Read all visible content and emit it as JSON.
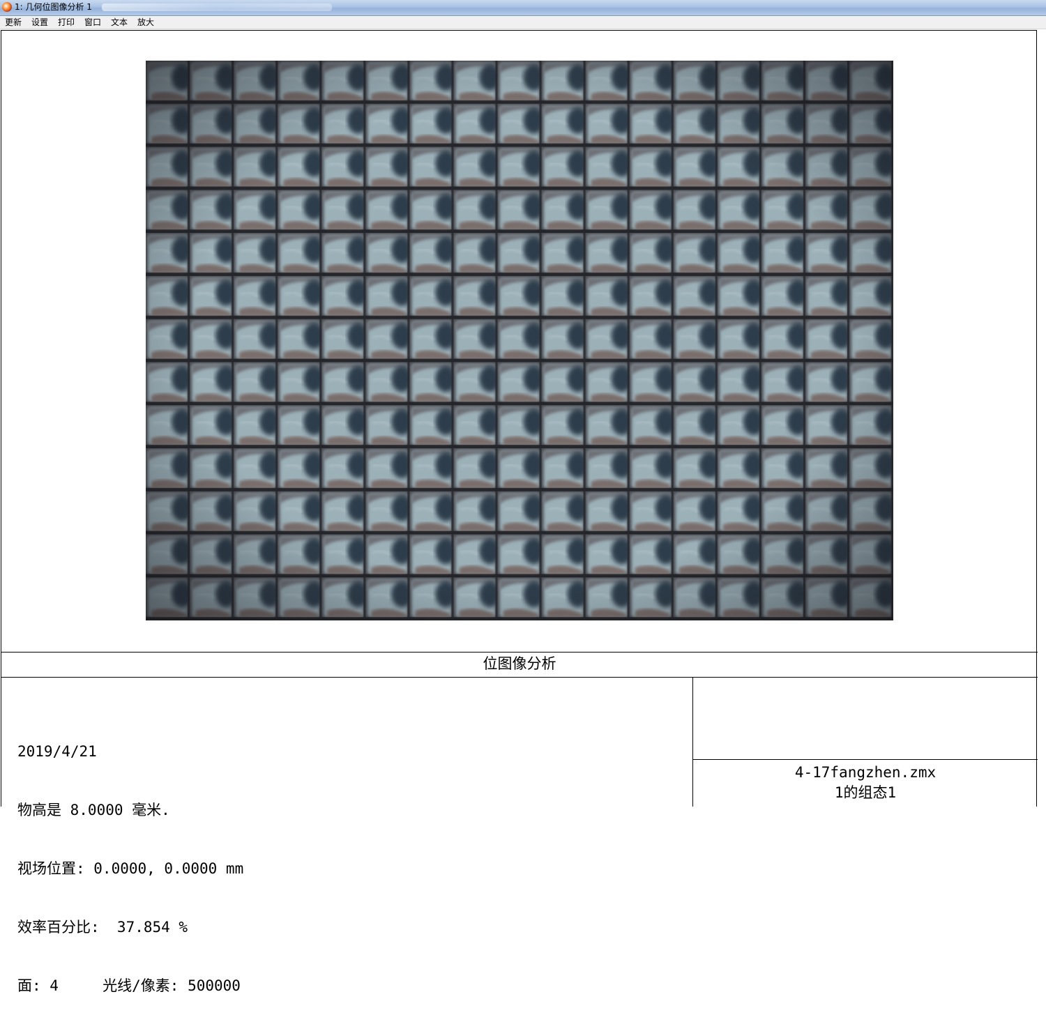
{
  "window": {
    "title": "1: 几何位图像分析 1",
    "icon": "zemax-app-icon"
  },
  "menu": [
    "更新",
    "设置",
    "打印",
    "窗口",
    "文本",
    "放大"
  ],
  "bitmap": {
    "description_icon": "tiled-eye-image",
    "grid_columns": 17,
    "grid_rows": 13,
    "colors": {
      "background": "#3c3e44",
      "skin": "#9cb0b8",
      "iris": "#2e3c4c",
      "lid": "#7a6e6c"
    }
  },
  "plot_title": "位图像分析",
  "info": {
    "date": "2019/4/21",
    "object_height": "物高是 8.0000 毫米.",
    "field_position": "视场位置: 0.0000, 0.0000 mm",
    "efficiency": "效率百分比:  37.854 %",
    "surface_rays": "面: 4     光线/像素: 500000"
  },
  "file": {
    "name": "4-17fangzhen.zmx",
    "config": "1的组态1"
  }
}
